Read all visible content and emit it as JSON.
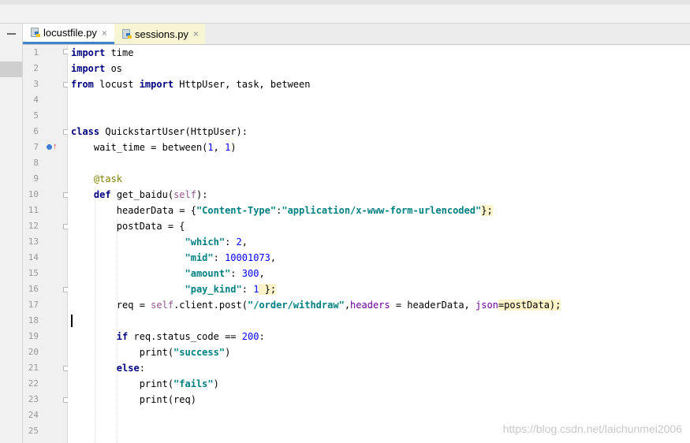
{
  "tabs": [
    {
      "label": "locustfile.py",
      "close": "×",
      "icon": "python-file-icon"
    },
    {
      "label": "sessions.py",
      "close": "×",
      "icon": "python-file-icon"
    }
  ],
  "line_numbers": [
    "1",
    "2",
    "3",
    "4",
    "5",
    "6",
    "7",
    "8",
    "9",
    "10",
    "11",
    "12",
    "13",
    "14",
    "15",
    "16",
    "17",
    "18",
    "19",
    "20",
    "21",
    "22",
    "23",
    "24",
    "25"
  ],
  "code": {
    "l1": [
      "import",
      " time"
    ],
    "l2": [
      "import",
      " os"
    ],
    "l3": [
      "from",
      " locust ",
      "import",
      " HttpUser, task, between"
    ],
    "l6": [
      "class",
      " QuickstartUser(HttpUser):"
    ],
    "l7": [
      "    wait_time = between(",
      "1",
      ", ",
      "1",
      ")"
    ],
    "l9": [
      "    @task"
    ],
    "l10": [
      "    ",
      "def",
      " get_baidu(",
      "self",
      "):"
    ],
    "l11": [
      "        headerData = {",
      "\"Content-Type\"",
      ":",
      "\"application/x-www-form-urlencoded\"",
      "};"
    ],
    "l12": [
      "        postData = {"
    ],
    "l13": [
      "                    ",
      "\"which\"",
      ": ",
      "2",
      ","
    ],
    "l14": [
      "                    ",
      "\"mid\"",
      ": ",
      "10001073",
      ","
    ],
    "l15": [
      "                    ",
      "\"amount\"",
      ": ",
      "300",
      ","
    ],
    "l16": [
      "                    ",
      "\"pay_kind\"",
      ": ",
      "1",
      " };"
    ],
    "l17": [
      "        req = ",
      "self",
      ".client.post(",
      "\"/order/withdraw\"",
      ",",
      "headers",
      " = headerData, ",
      "json",
      "=postData);"
    ],
    "l19": [
      "        ",
      "if",
      " req.status_code == ",
      "200",
      ":"
    ],
    "l20": [
      "            print(",
      "\"success\"",
      ")"
    ],
    "l21": [
      "        ",
      "else",
      ":"
    ],
    "l22": [
      "            print(",
      "\"fails\"",
      ")"
    ],
    "l23": [
      "            print(req)"
    ]
  },
  "watermark": "https://blog.csdn.net/laichunmei2006",
  "colors": {
    "keyword": "#000080",
    "string": "#008080",
    "number": "#0000ff",
    "self": "#94558d",
    "decorator": "#808000",
    "caret_line": "#fcf9e3",
    "active_tab_underline": "#4083c9"
  }
}
